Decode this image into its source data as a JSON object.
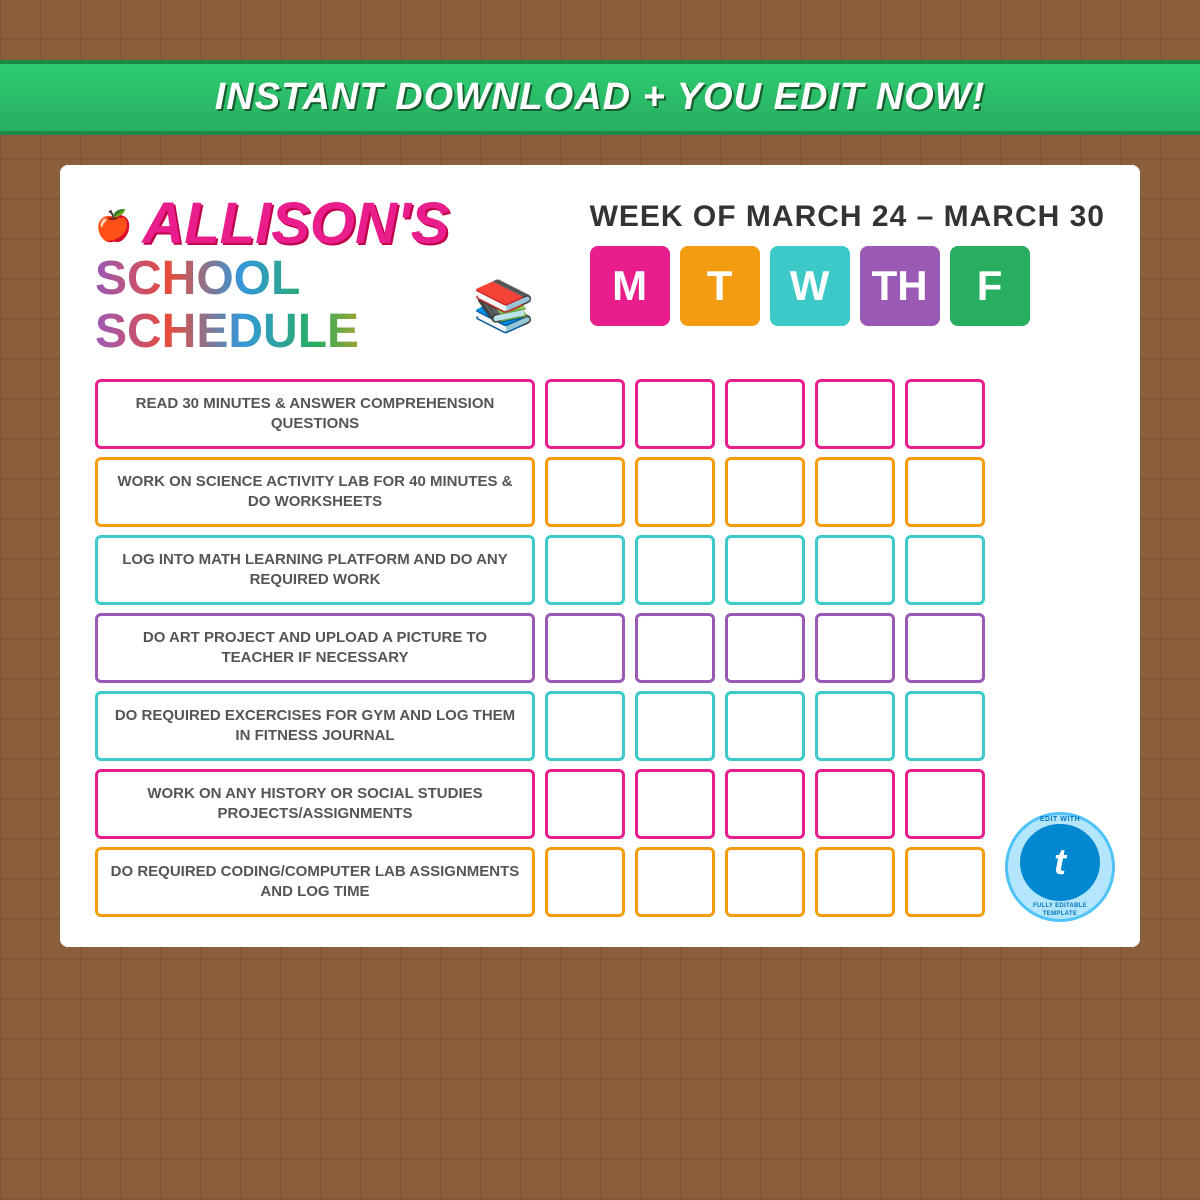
{
  "banner": {
    "text": "INSTANT DOWNLOAD + YOU EDIT NOW!"
  },
  "header": {
    "name": "ALLISON'S",
    "schedule": "SCHOOL SCHEDULE",
    "week_label": "WEEK OF MARCH 24 – MARCH 30",
    "days": [
      "M",
      "T",
      "W",
      "TH",
      "F"
    ]
  },
  "tasks": [
    {
      "id": 1,
      "text": "READ 30 MINUTES & ANSWER COMPREHENSION QUESTIONS",
      "color": "pink"
    },
    {
      "id": 2,
      "text": "WORK ON SCIENCE ACTIVITY LAB FOR 40 MINUTES & DO WORKSHEETS",
      "color": "orange"
    },
    {
      "id": 3,
      "text": "LOG INTO MATH LEARNING PLATFORM AND DO ANY REQUIRED WORK",
      "color": "teal"
    },
    {
      "id": 4,
      "text": "DO ART PROJECT AND UPLOAD A PICTURE TO TEACHER IF NECESSARY",
      "color": "purple"
    },
    {
      "id": 5,
      "text": "DO REQUIRED EXCERCISES FOR GYM AND LOG THEM IN FITNESS JOURNAL",
      "color": "cyan"
    },
    {
      "id": 6,
      "text": "WORK ON ANY HISTORY OR SOCIAL STUDIES PROJECTS/ASSIGNMENTS",
      "color": "hotpink"
    },
    {
      "id": 7,
      "text": "DO REQUIRED CODING/COMPUTER LAB ASSIGNMENTS AND LOG TIME",
      "color": "gold"
    }
  ],
  "templett": {
    "top_text": "EDIT WITH",
    "brand": "templett",
    "bottom_text": "FULLY EDITABLE TEMPLATE",
    "letter": "t"
  }
}
